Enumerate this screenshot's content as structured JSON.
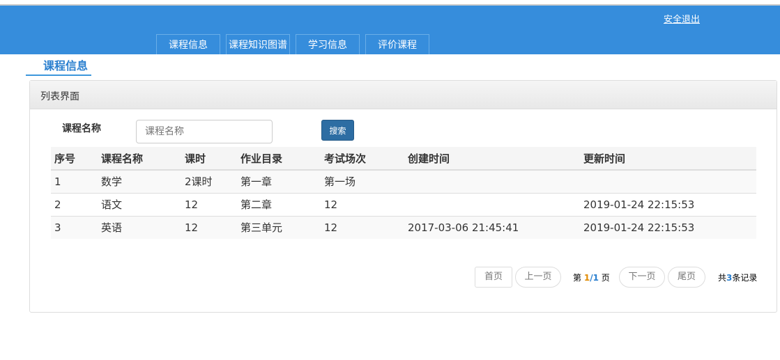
{
  "header": {
    "logout": "安全退出",
    "nav": [
      "课程信息",
      "课程知识图谱",
      "学习信息",
      "评价课程"
    ]
  },
  "page_title": "课程信息",
  "panel": {
    "title": "列表界面",
    "search_label": "课程名称",
    "search_placeholder": "课程名称",
    "search_button": "搜索"
  },
  "table": {
    "headers": [
      "序号",
      "课程名称",
      "课时",
      "作业目录",
      "考试场次",
      "创建时间",
      "更新时间"
    ],
    "rows": [
      [
        "1",
        "数学",
        "2课时",
        "第一章",
        "第一场",
        "",
        ""
      ],
      [
        "2",
        "语文",
        "12",
        "第二章",
        "12",
        "",
        "2019-01-24 22:15:53"
      ],
      [
        "3",
        "英语",
        "12",
        "第三单元",
        "12",
        "2017-03-06 21:45:41",
        "2019-01-24 22:15:53"
      ]
    ]
  },
  "pagination": {
    "first": "首页",
    "prev": "上一页",
    "page_prefix": "第",
    "page_current": "1",
    "page_sep": "/",
    "page_total": "1",
    "page_suffix": "页",
    "next": "下一页",
    "last": "尾页",
    "count_prefix": "共",
    "count": "3",
    "count_suffix": "条记录"
  }
}
